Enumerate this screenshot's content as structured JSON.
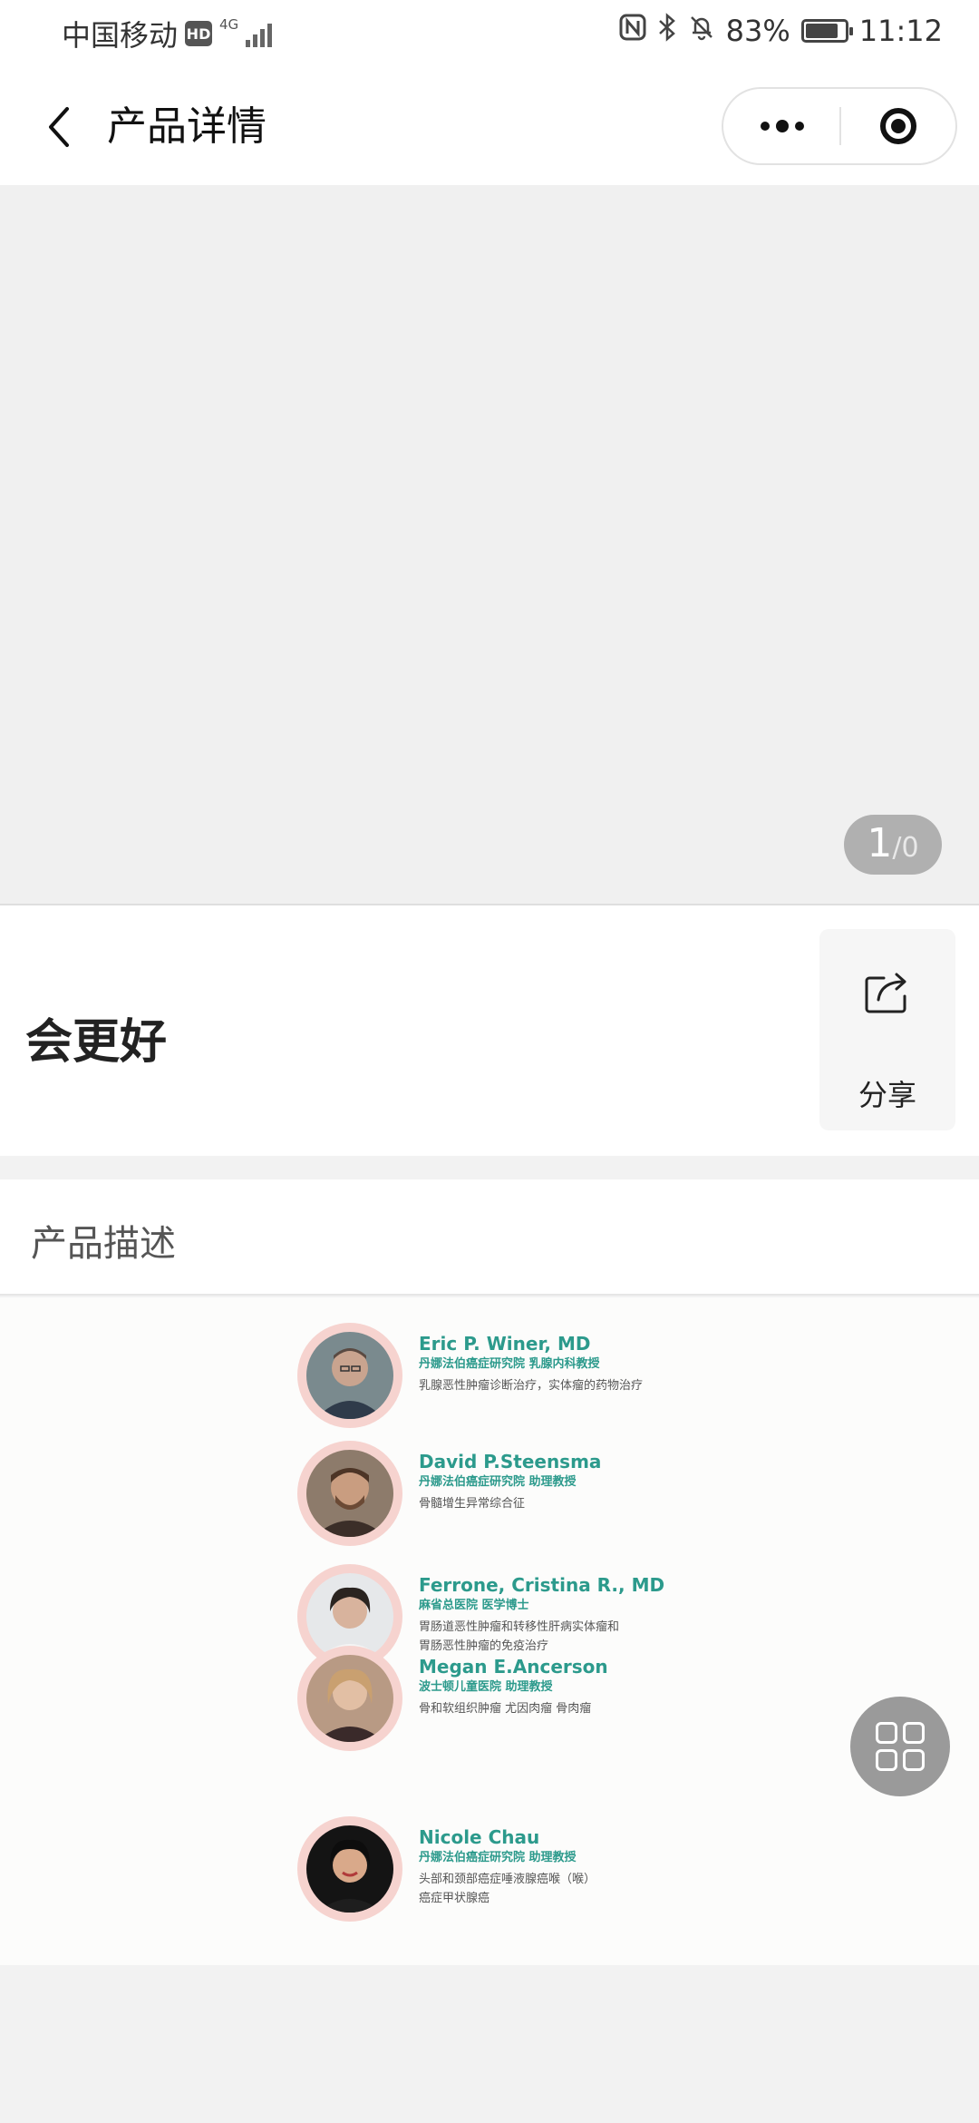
{
  "status_bar": {
    "carrier": "中国移动",
    "hd_badge": "HD",
    "network_type": "4G",
    "battery_percent": "83%",
    "battery_level": 0.83,
    "time": "11:12"
  },
  "nav": {
    "title": "产品详情"
  },
  "carousel": {
    "current": "1",
    "separator": "/",
    "total": "0"
  },
  "product": {
    "name": "会更好",
    "share_label": "分享"
  },
  "description": {
    "title": "产品描述",
    "doctors": [
      {
        "name": "Eric P. Winer, MD",
        "institution": "丹娜法伯癌症研究院  乳腺内科教授",
        "specialty": [
          "乳腺恶性肿瘤诊断治疗，实体瘤的药物治疗"
        ]
      },
      {
        "name": "David P.Steensma",
        "institution": "丹娜法伯癌症研究院    助理教授",
        "specialty": [
          "骨髓增生异常综合征"
        ]
      },
      {
        "name": "Ferrone, Cristina R., MD",
        "institution": "麻省总医院  医学博士",
        "specialty": [
          "胃肠道恶性肿瘤和转移性肝病实体瘤和",
          "胃肠恶性肿瘤的免疫治疗"
        ]
      },
      {
        "name": "Megan E.Ancerson",
        "institution": "波士顿儿童医院  助理教授",
        "specialty": [
          "骨和软组织肿瘤 尤因肉瘤 骨肉瘤"
        ]
      },
      {
        "name": "Nicole Chau",
        "institution": "丹娜法伯癌症研究院  助理教授",
        "specialty": [
          "头部和颈部癌症唾液腺癌喉（喉）",
          "癌症甲状腺癌"
        ]
      }
    ]
  },
  "colors": {
    "accent_teal": "#2c9a8c",
    "avatar_ring": "#f6d3cf",
    "page_bg": "#f2f2f2"
  },
  "icons": [
    "back-arrow-icon",
    "more-dots-icon",
    "close-target-icon",
    "share-icon",
    "grid-icon",
    "nfc-icon",
    "bluetooth-icon",
    "mute-bell-icon",
    "battery-icon",
    "signal-icon"
  ]
}
